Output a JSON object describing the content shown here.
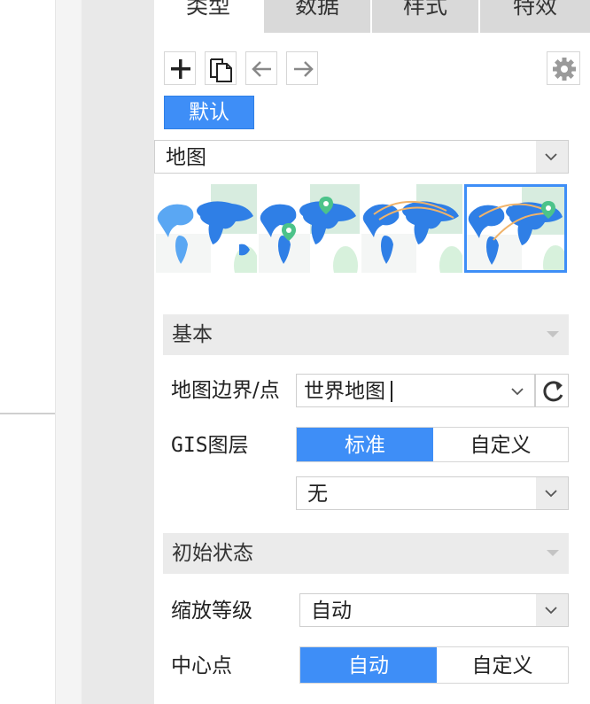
{
  "tabs": [
    {
      "label": "类型",
      "active": true
    },
    {
      "label": "数据",
      "active": false
    },
    {
      "label": "样式",
      "active": false
    },
    {
      "label": "特效",
      "active": false
    }
  ],
  "toolbar": {
    "add_icon": "plus-icon",
    "copy_icon": "copy-icon",
    "back_icon": "arrow-left-icon",
    "forward_icon": "arrow-right-icon",
    "settings_icon": "gear-icon"
  },
  "default_badge": "默认",
  "chart_type_select": {
    "value": "地图"
  },
  "thumbnails": [
    {
      "name": "region-map",
      "selected": false
    },
    {
      "name": "point-map",
      "selected": false
    },
    {
      "name": "flow-map",
      "selected": false
    },
    {
      "name": "flow-point-map",
      "selected": true
    }
  ],
  "sections": {
    "basic": {
      "title": "基本"
    },
    "initial_state": {
      "title": "初始状态"
    }
  },
  "basic": {
    "boundary_label": "地图边界/点",
    "boundary_value": "世界地图",
    "gis_label": "GIS图层",
    "gis_options": [
      "标准",
      "自定义"
    ],
    "gis_selected": "标准",
    "gis_select_value": "无"
  },
  "initial": {
    "zoom_label": "缩放等级",
    "zoom_value": "自动",
    "center_label": "中心点",
    "center_options": [
      "自动",
      "自定义"
    ],
    "center_selected": "自动"
  },
  "colors": {
    "accent": "#3e8ef7",
    "map_blue": "#2f7fe6",
    "pin_green": "#4cc38a",
    "flow_line": "#f0b36a"
  }
}
